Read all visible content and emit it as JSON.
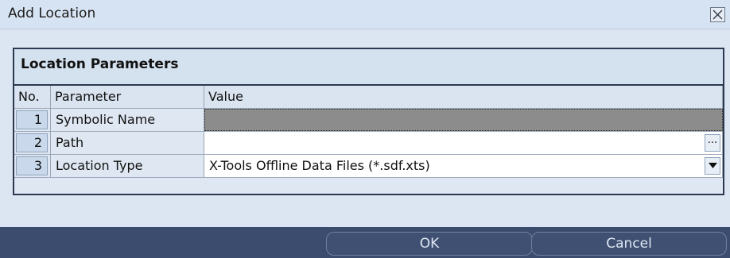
{
  "window": {
    "title": "Add Location"
  },
  "section": {
    "title": "Location Parameters"
  },
  "table": {
    "columns": [
      "No.",
      "Parameter",
      "Value"
    ],
    "rows": [
      {
        "no": "1",
        "parameter": "Symbolic Name",
        "value": ""
      },
      {
        "no": "2",
        "parameter": "Path",
        "value": ""
      },
      {
        "no": "3",
        "parameter": "Location Type",
        "value": "X-Tools Offline Data Files (*.sdf.xts)"
      }
    ]
  },
  "path_browse_label": "...",
  "buttons": {
    "ok": "OK",
    "cancel": "Cancel"
  },
  "icons": {
    "close": "close-icon",
    "dropdown": "chevron-down-icon"
  },
  "colors": {
    "footer": "#3c4c6e",
    "grid_border": "#2c3850",
    "symbolic_name_bg": "#8c8c8c"
  }
}
